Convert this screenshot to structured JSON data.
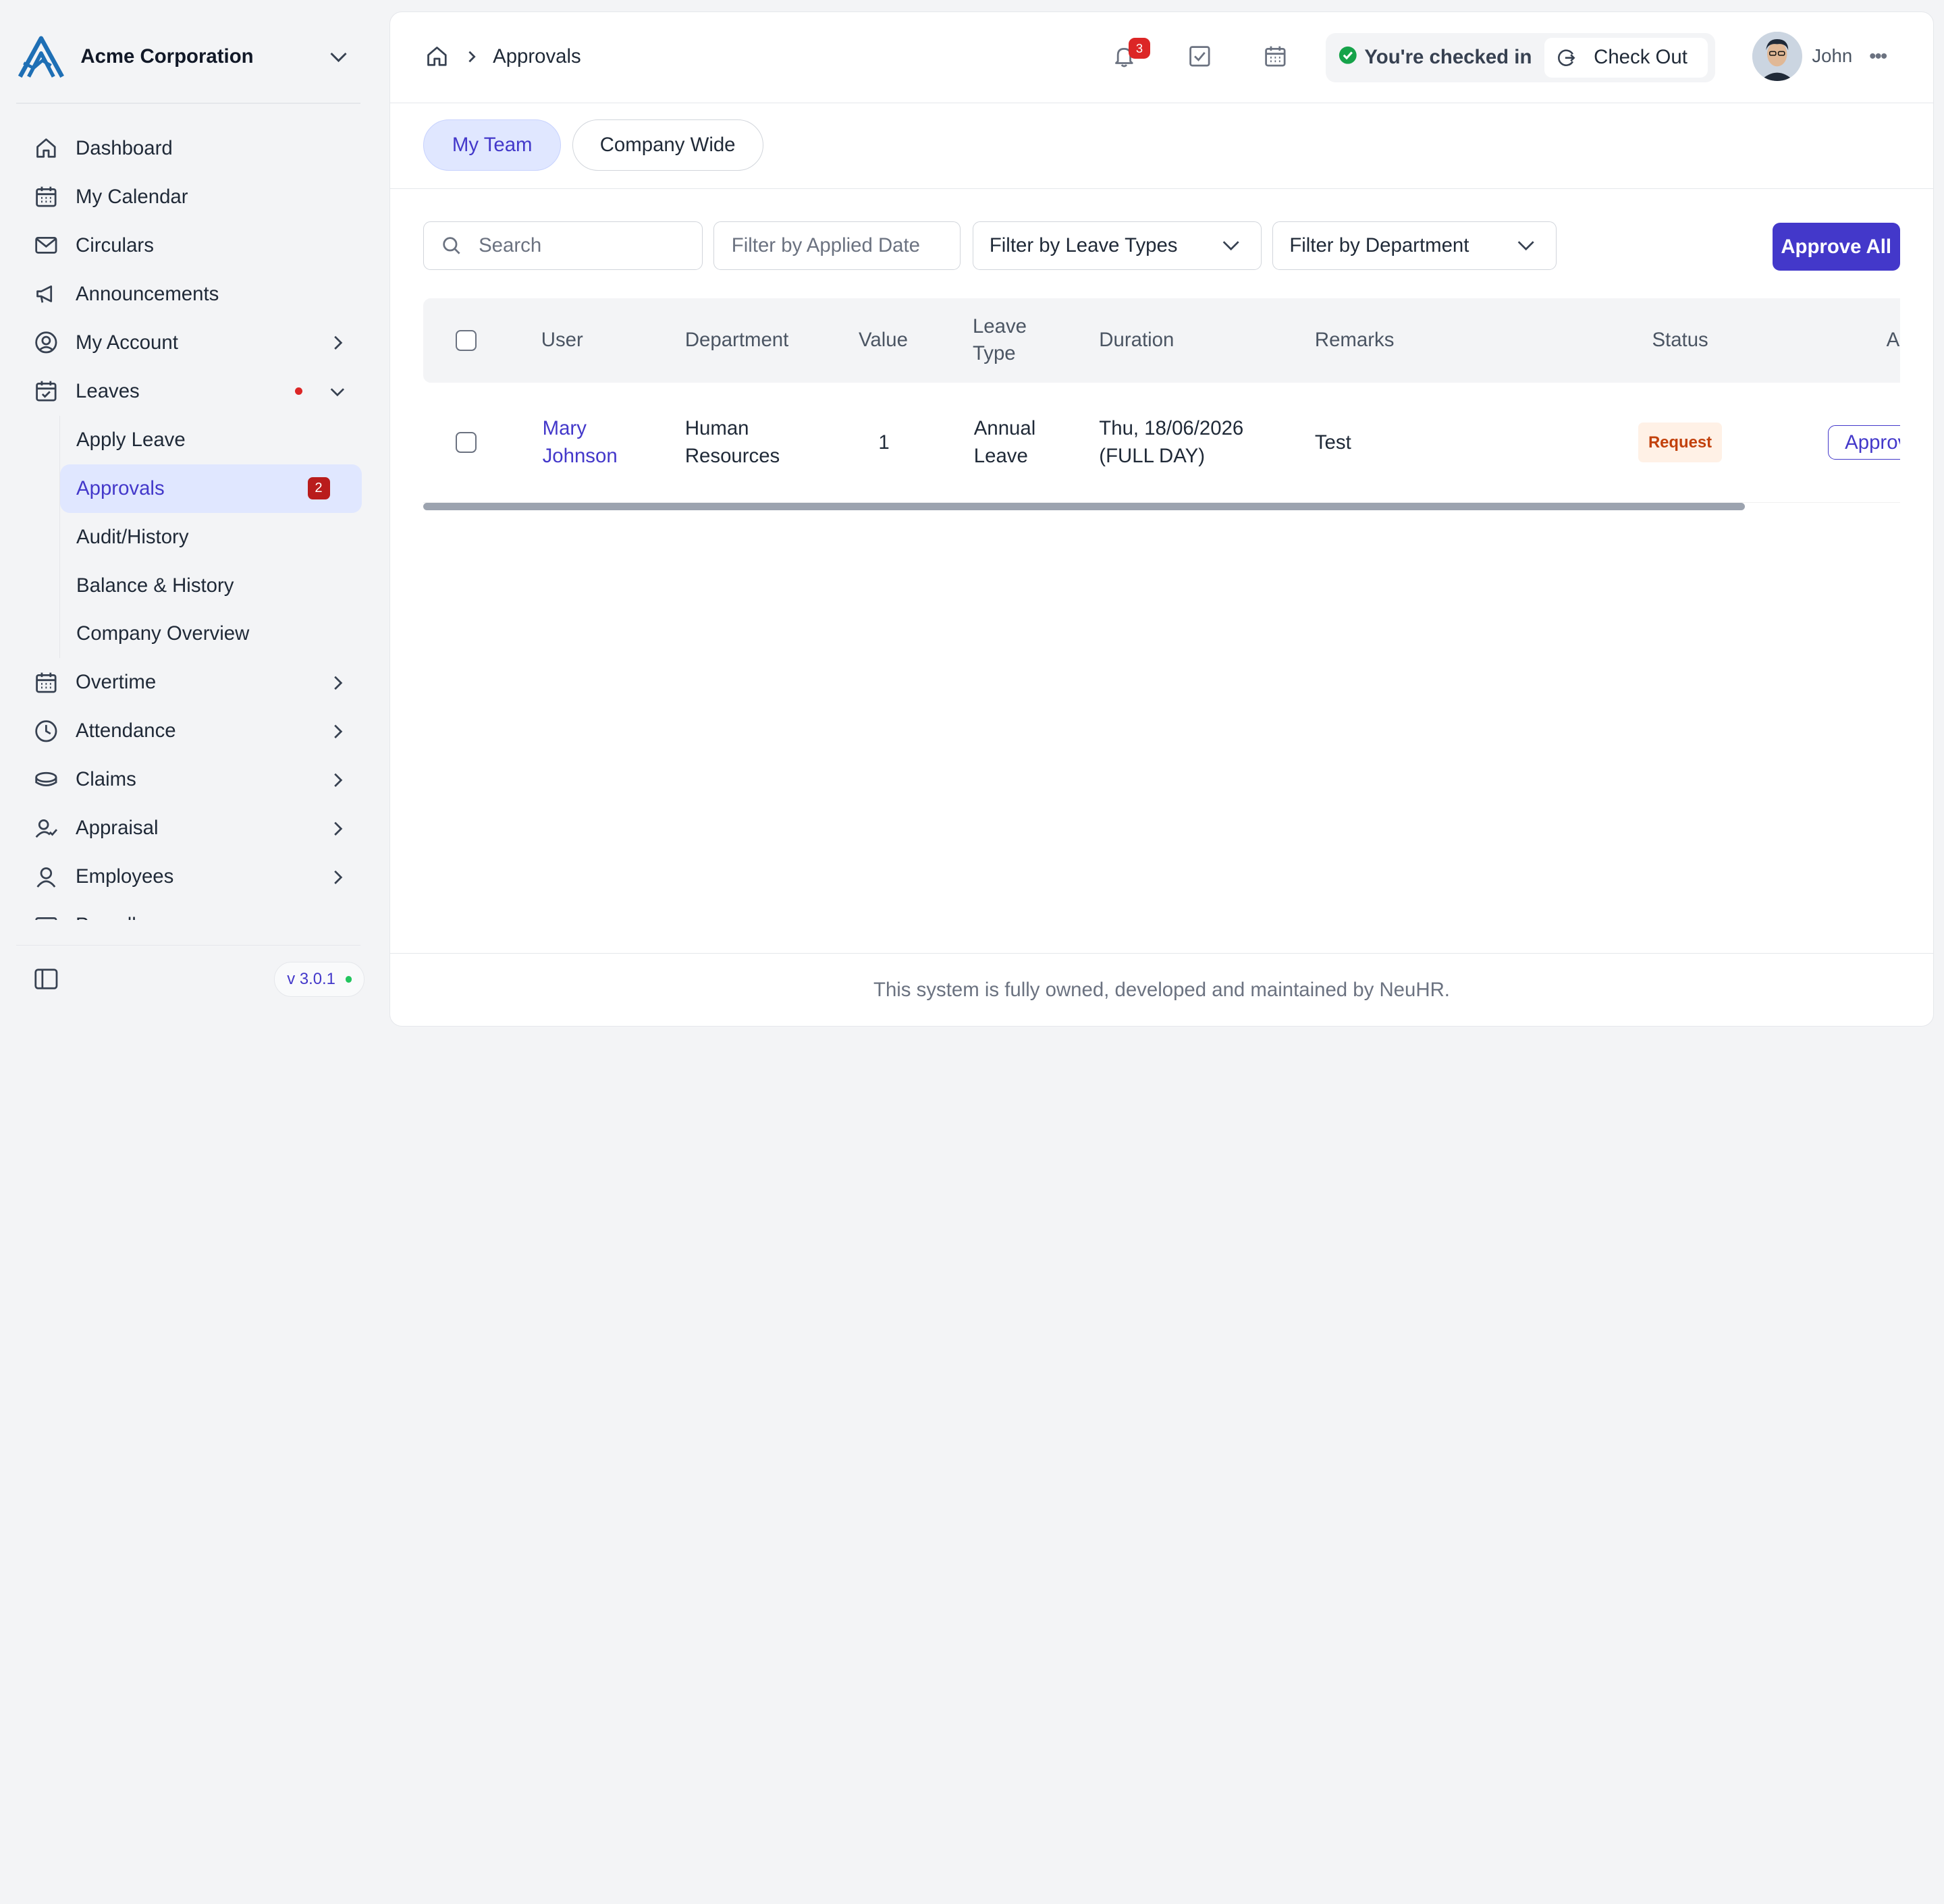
{
  "brand": {
    "name": "Acme Corporation",
    "logo_icon": "acme-logo-icon"
  },
  "colors": {
    "accent": "#4338ca",
    "accent_light": "#e0e7ff",
    "danger": "#dc2626",
    "success": "#22c55e",
    "status_request_bg": "#fff1e6",
    "status_request_fg": "#c2410c"
  },
  "sidebar": {
    "items": [
      {
        "label": "Dashboard",
        "icon": "home-icon"
      },
      {
        "label": "My Calendar",
        "icon": "calendar-icon"
      },
      {
        "label": "Circulars",
        "icon": "mail-icon"
      },
      {
        "label": "Announcements",
        "icon": "megaphone-icon"
      },
      {
        "label": "My Account",
        "icon": "user-circle-icon"
      },
      {
        "label": "Leaves",
        "icon": "calendar-check-icon"
      }
    ],
    "leaves_sub": [
      {
        "label": "Apply Leave"
      },
      {
        "label": "Approvals",
        "badge": "2"
      },
      {
        "label": "Audit/History"
      },
      {
        "label": "Balance & History"
      },
      {
        "label": "Company Overview"
      }
    ],
    "items_after": [
      {
        "label": "Overtime",
        "icon": "calendar-icon"
      },
      {
        "label": "Attendance",
        "icon": "clock-icon"
      },
      {
        "label": "Claims",
        "icon": "coins-icon"
      },
      {
        "label": "Appraisal",
        "icon": "user-check-icon"
      },
      {
        "label": "Employees",
        "icon": "user-icon"
      },
      {
        "label": "Payroll",
        "icon": "card-icon"
      }
    ],
    "version": "v 3.0.1"
  },
  "header": {
    "breadcrumb": "Approvals",
    "notifications_count": "3",
    "checkin_text": "You're checked in",
    "checkout_label": "Check Out",
    "user_name": "John"
  },
  "tabs": [
    {
      "label": "My Team"
    },
    {
      "label": "Company Wide"
    }
  ],
  "filters": {
    "search_placeholder": "Search",
    "applied_date_placeholder": "Filter by Applied Date",
    "leave_types": "Filter by Leave Types",
    "department": "Filter by Department",
    "approve_all": "Approve All"
  },
  "table": {
    "headers": {
      "user": "User",
      "department": "Department",
      "value": "Value",
      "leave_type_1": "Leave",
      "leave_type_2": "Type",
      "duration": "Duration",
      "remarks": "Remarks",
      "status": "Status",
      "action": "Action"
    },
    "rows": [
      {
        "user_1": "Mary",
        "user_2": "Johnson",
        "department_1": "Human",
        "department_2": "Resources",
        "value": "1",
        "leave_type_1": "Annual",
        "leave_type_2": "Leave",
        "duration_1": "Thu, 18/06/2026",
        "duration_2": "(FULL DAY)",
        "remarks": "Test",
        "status": "Request",
        "action": "Approve"
      }
    ]
  },
  "footer": {
    "text": "This system is fully owned, developed and maintained by NeuHR."
  }
}
